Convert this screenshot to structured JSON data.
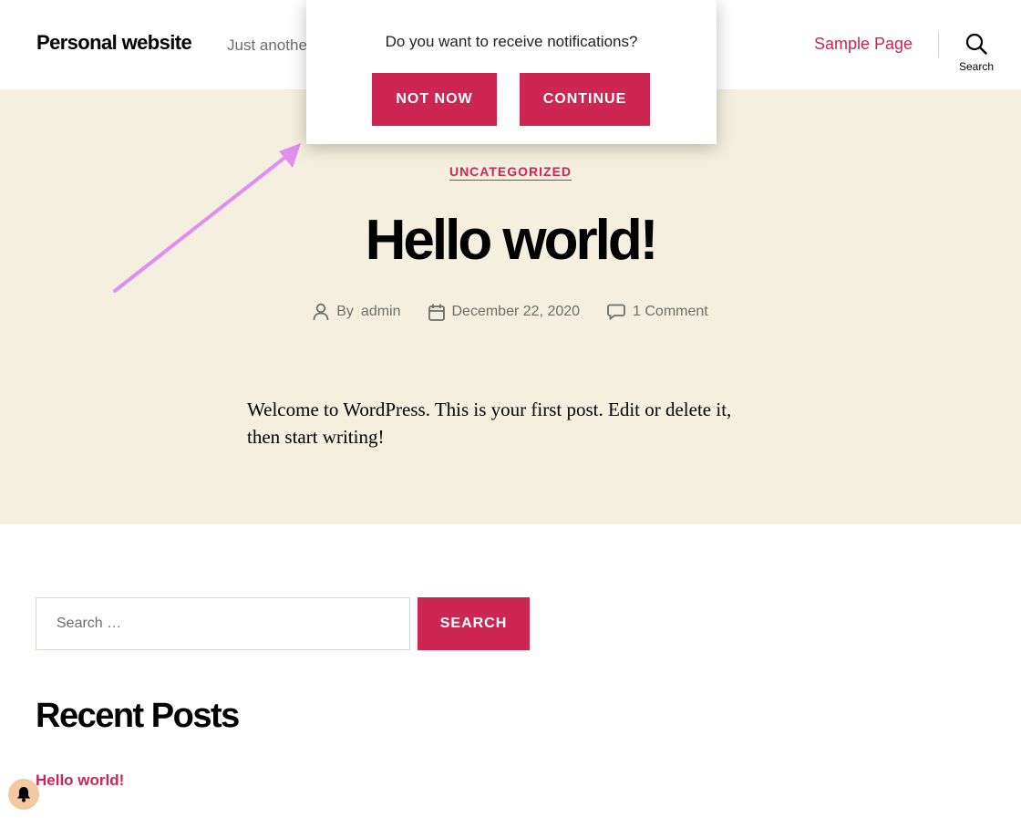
{
  "header": {
    "site_title": "Personal website",
    "tagline": "Just anothe",
    "nav_link": "Sample Page",
    "search_label": "Search"
  },
  "popup": {
    "message": "Do you want to receive notifications?",
    "not_now_label": "NOT NOW",
    "continue_label": "CONTINUE"
  },
  "post": {
    "category": "UNCATEGORIZED",
    "title": "Hello world!",
    "author_prefix": "By",
    "author": "admin",
    "date": "December 22, 2020",
    "comments": "1 Comment",
    "body": "Welcome to WordPress. This is your first post. Edit or delete it, then start writing!"
  },
  "search_widget": {
    "placeholder": "Search …",
    "submit_label": "SEARCH"
  },
  "recent_posts": {
    "heading": "Recent Posts",
    "items": [
      "Hello world!"
    ]
  },
  "colors": {
    "accent": "#cd2653",
    "hero_bg": "#f5efe0",
    "annotation_arrow": "#e08ef0"
  },
  "icons": {
    "search": "search-icon",
    "author": "person-icon",
    "date": "calendar-icon",
    "comments": "comment-icon",
    "bell": "bell-icon"
  }
}
